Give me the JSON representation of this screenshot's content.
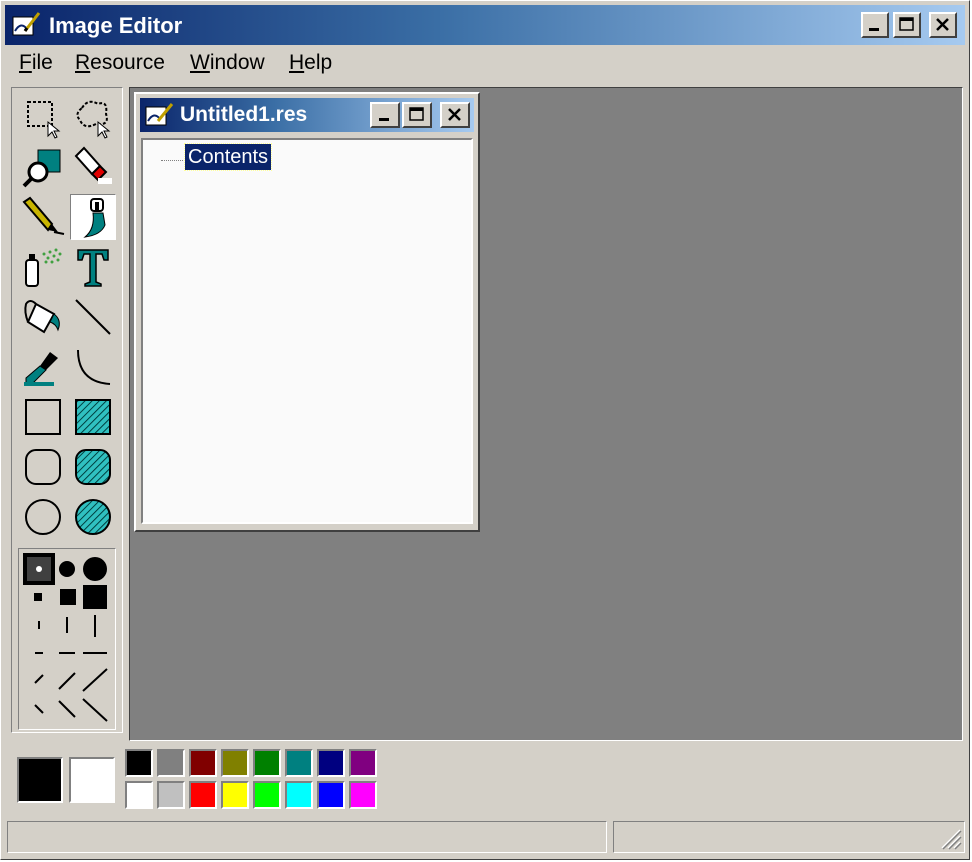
{
  "app": {
    "title": "Image Editor",
    "icon": "image-editor-icon"
  },
  "window_controls": [
    "minimize-icon",
    "maximize-icon",
    "close-icon"
  ],
  "menu": [
    {
      "pre": "",
      "ul": "F",
      "post": "ile"
    },
    {
      "pre": "",
      "ul": "R",
      "post": "esource"
    },
    {
      "pre": "",
      "ul": "W",
      "post": "indow"
    },
    {
      "pre": "",
      "ul": "H",
      "post": "elp"
    }
  ],
  "tools": [
    {
      "name": "rectangle-select-icon",
      "active": false
    },
    {
      "name": "freeform-select-icon",
      "active": false
    },
    {
      "name": "zoom-icon",
      "active": false
    },
    {
      "name": "eraser-icon",
      "active": false
    },
    {
      "name": "pencil-icon",
      "active": false
    },
    {
      "name": "brush-icon",
      "active": true
    },
    {
      "name": "airbrush-icon",
      "active": false
    },
    {
      "name": "text-icon",
      "active": false
    },
    {
      "name": "fill-icon",
      "active": false
    },
    {
      "name": "line-icon",
      "active": false
    },
    {
      "name": "color-picker-icon",
      "active": false
    },
    {
      "name": "curve-icon",
      "active": false
    },
    {
      "name": "rectangle-icon",
      "active": false
    },
    {
      "name": "filled-rectangle-icon",
      "active": false
    },
    {
      "name": "rounded-rectangle-icon",
      "active": false
    },
    {
      "name": "filled-rounded-rectangle-icon",
      "active": false
    },
    {
      "name": "ellipse-icon",
      "active": false
    },
    {
      "name": "filled-ellipse-icon",
      "active": false
    }
  ],
  "child_window": {
    "title": "Untitled1.res",
    "tree_root": "Contents"
  },
  "colors": {
    "foreground": "#000000",
    "background": "#ffffff",
    "palette": [
      "#000000",
      "#808080",
      "#800000",
      "#808000",
      "#008000",
      "#008080",
      "#000080",
      "#800080",
      "#ffffff",
      "#c0c0c0",
      "#ff0000",
      "#ffff00",
      "#00ff00",
      "#00ffff",
      "#0000ff",
      "#ff00ff"
    ]
  }
}
